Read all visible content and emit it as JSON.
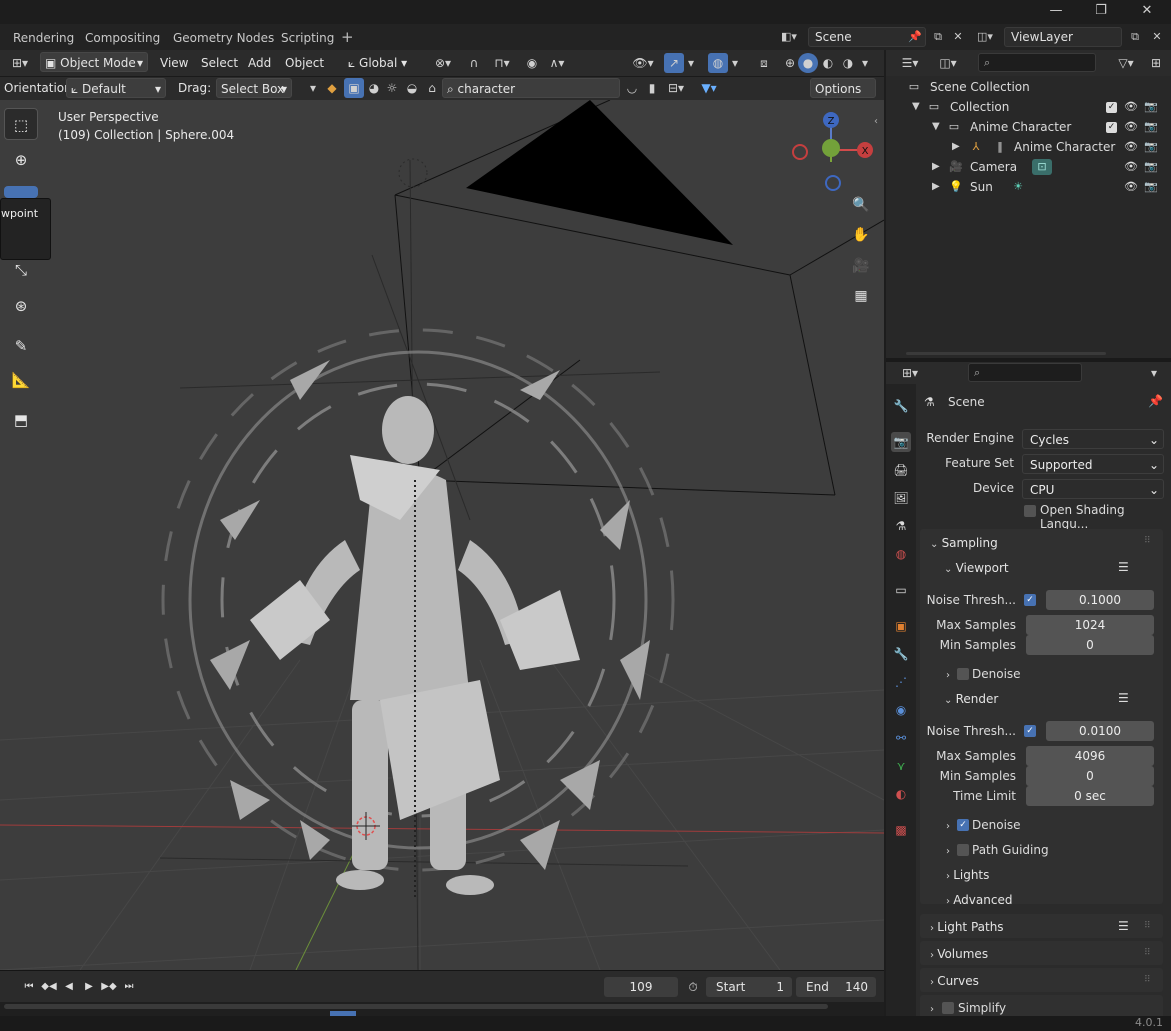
{
  "window_controls": {
    "minimize": "—",
    "maximize": "❐",
    "close": "✕"
  },
  "workspace_tabs": [
    "Rendering",
    "Compositing",
    "Geometry Nodes",
    "Scripting"
  ],
  "workspace_add": "+",
  "scene_field": "Scene",
  "viewlayer_field": "ViewLayer",
  "viewport_header": {
    "mode": "Object Mode",
    "menus": [
      "View",
      "Select",
      "Add",
      "Object"
    ],
    "transform": "Global"
  },
  "tool_settings": {
    "orientation_label": "Orientation:",
    "orientation_value": "Default",
    "drag_label": "Drag:",
    "drag_value": "Select Box",
    "filter_text": "character",
    "options_label": "Options"
  },
  "viewport": {
    "perspective_label": "User Perspective",
    "collection_label": "(109) Collection | Sphere.004",
    "tooltip_text": "wpoint",
    "gizmo": {
      "z": "Z",
      "x": "X"
    }
  },
  "timeline": {
    "current_frame": "109",
    "start_label": "Start",
    "start_value": "1",
    "end_label": "End",
    "end_value": "140"
  },
  "outliner": {
    "rows": [
      {
        "label": "Scene Collection"
      },
      {
        "label": "Collection"
      },
      {
        "label": "Anime Character"
      },
      {
        "label": "Anime Character"
      },
      {
        "label": "Camera"
      },
      {
        "label": "Sun"
      }
    ]
  },
  "properties": {
    "context": "Scene",
    "render_engine_label": "Render Engine",
    "render_engine": "Cycles",
    "feature_set_label": "Feature Set",
    "feature_set": "Supported",
    "device_label": "Device",
    "device": "CPU",
    "osl_label": "Open Shading Langu...",
    "sampling": "Sampling",
    "viewport_section": "Viewport",
    "vp_noise_label": "Noise Thresh...",
    "vp_noise": "0.1000",
    "vp_max_label": "Max Samples",
    "vp_max": "1024",
    "vp_min_label": "Min Samples",
    "vp_min": "0",
    "vp_denoise": "Denoise",
    "render_section": "Render",
    "r_noise_label": "Noise Thresh...",
    "r_noise": "0.0100",
    "r_max_label": "Max Samples",
    "r_max": "4096",
    "r_min_label": "Min Samples",
    "r_min": "0",
    "r_time_label": "Time Limit",
    "r_time": "0 sec",
    "r_denoise": "Denoise",
    "path_guiding": "Path Guiding",
    "lights": "Lights",
    "advanced": "Advanced",
    "light_paths": "Light Paths",
    "volumes": "Volumes",
    "curves": "Curves",
    "simplify": "Simplify"
  },
  "version": "4.0.1",
  "colors": {
    "accent": "#4772b3",
    "viewport_bg": "#3d3d3d",
    "panel_bg": "#2b2b2b"
  }
}
